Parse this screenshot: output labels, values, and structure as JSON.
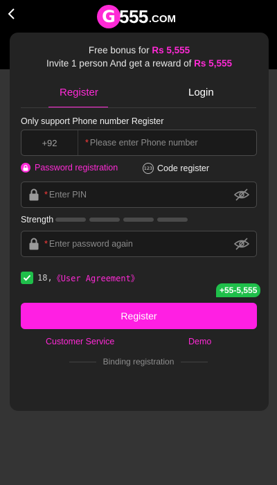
{
  "header": {
    "logo_g": "G",
    "logo_text": "555",
    "logo_tld": ".COM"
  },
  "bonus": {
    "line1_prefix": "Free bonus for ",
    "line1_amount": "Rs 5,555",
    "line2_prefix": "Invite 1 person And get a reward of ",
    "line2_amount": "Rs 5,555"
  },
  "tabs": [
    {
      "label": "Register",
      "active": true
    },
    {
      "label": "Login",
      "active": false
    }
  ],
  "form": {
    "only_support": "Only support Phone number Register",
    "phone_prefix": "+92",
    "phone_placeholder": "Please enter Phone number",
    "method_password": "Password registration",
    "method_code": "Code register",
    "code_icon_text": "123",
    "pin_placeholder": "Enter PIN",
    "strength_label": "Strength",
    "password_again_placeholder": "Enter password again",
    "agree_age": "18,",
    "agree_link": "《User Agreement》",
    "agree_checked": true
  },
  "reward_badge": "+55-5,555",
  "register_button": "Register",
  "links": {
    "customer_service": "Customer Service",
    "demo": "Demo"
  },
  "binding": "Binding registration",
  "colors": {
    "accent": "#ff2ad6",
    "button": "#ff1fe3",
    "success": "#1fbf4a",
    "card": "#232323",
    "background": "#343434"
  },
  "icons": [
    "back-arrow-icon",
    "lock-icon",
    "eye-slash-icon",
    "checkmark-icon",
    "code-123-icon",
    "password-lock-icon"
  ]
}
